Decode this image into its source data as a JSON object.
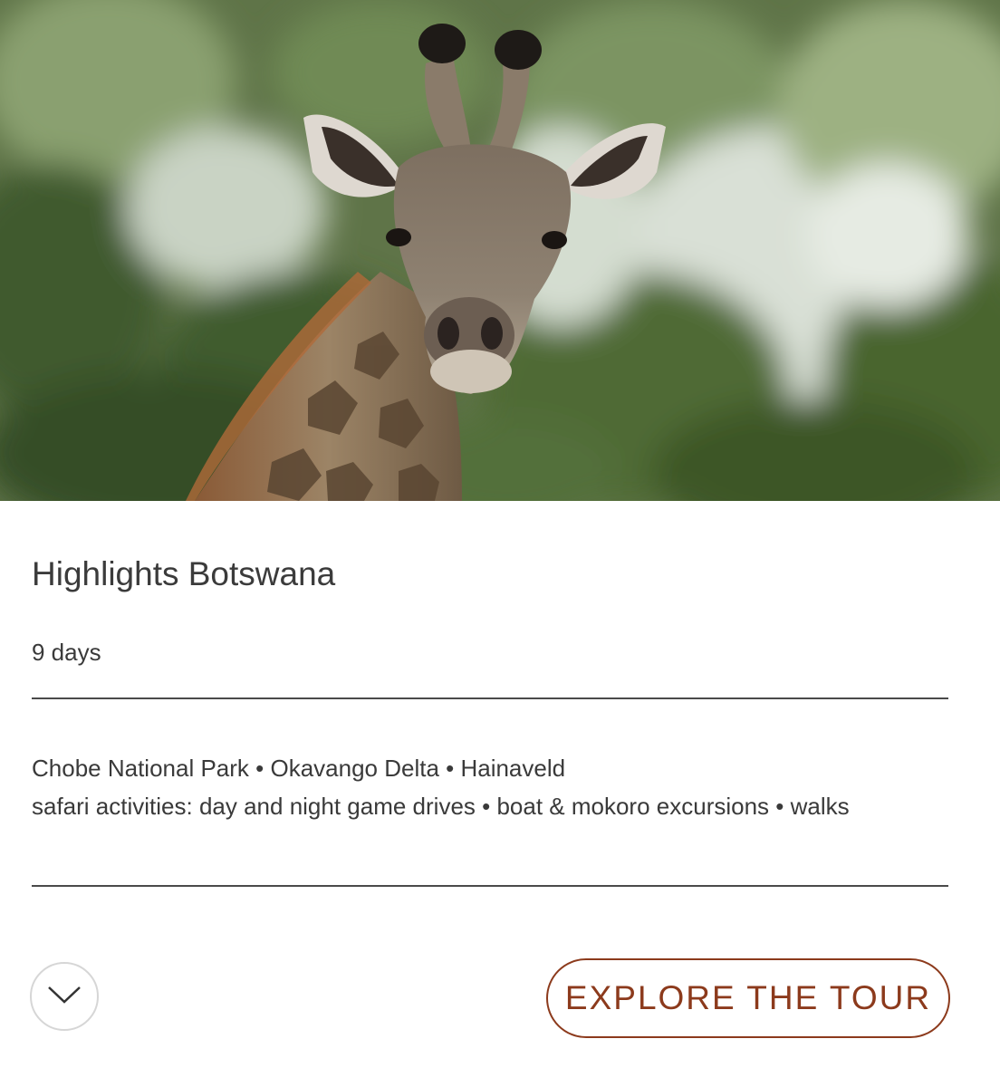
{
  "tour": {
    "image_alt": "Giraffe",
    "title": "Highlights Botswana",
    "duration": "9 days",
    "highlights": [
      "Chobe National Park • Okavango Delta • Hainaveld",
      "safari activities: day and night game drives • boat & mokoro excursions • walks"
    ],
    "cta_label": "EXPLORE THE TOUR",
    "expand_icon": "chevron-down-icon"
  },
  "colors": {
    "accent": "#8c3a1c",
    "text": "#3a3a3a",
    "rule": "#4a4a4a",
    "circle_border": "#d6d6d6"
  }
}
